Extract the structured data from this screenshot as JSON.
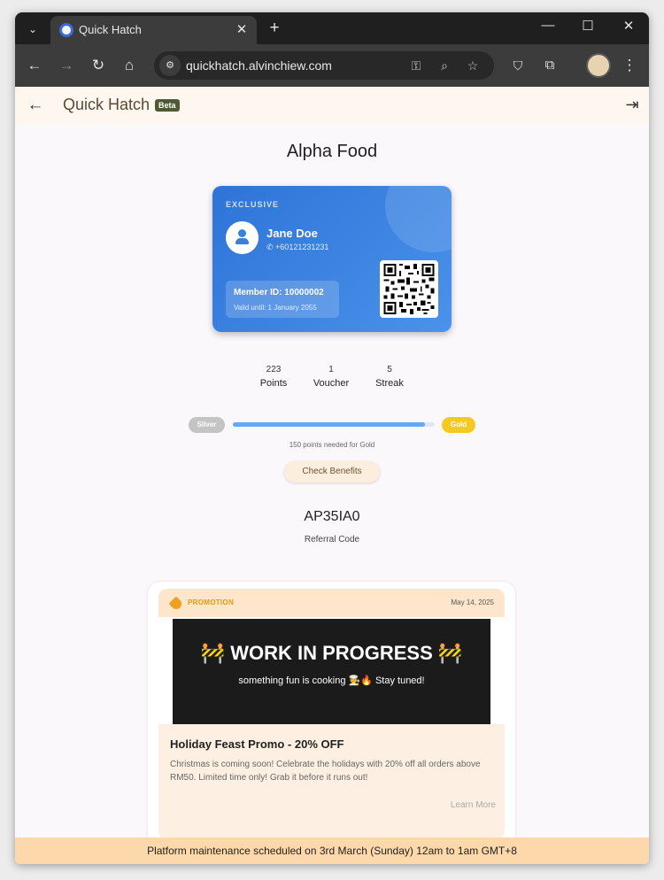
{
  "browser": {
    "tab_title": "Quick Hatch",
    "url": "quickhatch.alvinchiew.com",
    "icons": [
      "tab-search-icon",
      "close-icon",
      "plus-icon",
      "minimize-icon",
      "maximize-icon",
      "close-window-icon",
      "back-icon",
      "forward-icon",
      "reload-icon",
      "home-icon",
      "site-info-icon",
      "password-key-icon",
      "zoom-icon",
      "star-icon",
      "shield-extension-icon",
      "extensions-icon",
      "profile-avatar-icon",
      "more-menu-icon"
    ]
  },
  "appbar": {
    "title": "Quick Hatch",
    "badge": "Beta"
  },
  "merchant": "Alpha Food",
  "card": {
    "tier_label": "EXCLUSIVE",
    "name": "Jane Doe",
    "phone": "+60121231231",
    "member_id": "Member ID: 10000002",
    "valid_until": "Valid until: 1 January 2055",
    "accent_color": "#2e74d8"
  },
  "stats": [
    {
      "value": "223",
      "label": "Points"
    },
    {
      "value": "1",
      "label": "Voucher"
    },
    {
      "value": "5",
      "label": "Streak"
    }
  ],
  "tier_progress": {
    "current_tier": "Silver",
    "next_tier": "Gold",
    "progress_fraction": 0.95,
    "points_needed": "150 points needed for Gold",
    "benefits_button": "Check Benefits"
  },
  "referral": {
    "code": "AP35IA0",
    "label": "Referral Code"
  },
  "promotion": {
    "tag": "PROMOTION",
    "date": "May 14, 2025",
    "image_title": "🚧 WORK IN PROGRESS 🚧",
    "image_subtitle": "something fun is cooking 🧑‍🍳🔥 Stay tuned!",
    "title": "Holiday Feast Promo - 20% OFF",
    "description": "Christmas is coming soon! Celebrate the holidays with 20% off all orders above RM50. Limited time only! Grab it before it runs out!",
    "link": "Learn More"
  },
  "banner": "Platform maintenance scheduled on 3rd March (Sunday) 12am to 1am GMT+8"
}
